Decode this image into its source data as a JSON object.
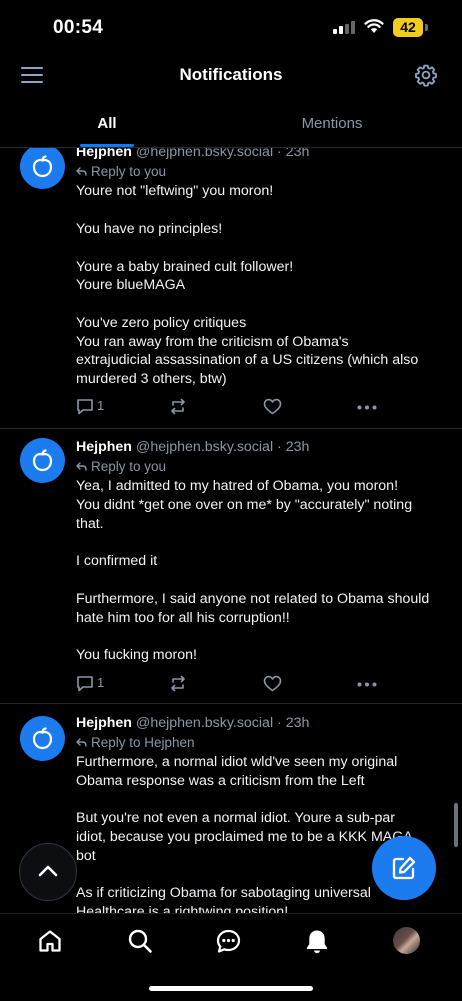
{
  "status_bar": {
    "time": "00:54",
    "battery": "42"
  },
  "header": {
    "title": "Notifications"
  },
  "tabs": [
    {
      "label": "All",
      "selected": true
    },
    {
      "label": "Mentions",
      "selected": false
    }
  ],
  "posts": [
    {
      "author": "Hejphen",
      "handle": "@hejphen.bsky.social",
      "time": "· 23h",
      "reply_to": "Reply to you",
      "body": [
        "Youre not \"leftwing\" you moron!",
        "",
        "You have no principles!",
        "",
        "Youre a baby brained cult follower!",
        "Youre blueMAGA",
        "",
        "You've zero policy critiques",
        "You ran away from the criticism of Obama's",
        "extrajudicial assassination of a US citizens (which also",
        "murdered 3 others, btw)"
      ],
      "reply_count": "1"
    },
    {
      "author": "Hejphen",
      "handle": "@hejphen.bsky.social",
      "time": "· 23h",
      "reply_to": "Reply to you",
      "body": [
        "Yea, I admitted to my hatred of Obama, you moron!",
        "You didnt *get one over on me* by \"accurately\" noting",
        "that.",
        "",
        "I confirmed it",
        "",
        "Furthermore, I said anyone not related to Obama should",
        "hate him too for all his corruption!!",
        "",
        "You fucking moron!"
      ],
      "reply_count": "1"
    },
    {
      "author": "Hejphen",
      "handle": "@hejphen.bsky.social",
      "time": "· 23h",
      "reply_to": "Reply to Hejphen",
      "body": [
        "Furthermore, a normal idiot wld've seen my original",
        "Obama response was a criticism from the Left",
        "",
        "But you're not even a normal idiot. Youre a sub-par",
        "idiot, because you proclaimed me to be a KKK MAGA",
        "bot",
        "",
        "As if criticizing Obama for sabotaging universal",
        "Healthcare is a rightwing position!"
      ],
      "reply_count": ""
    }
  ],
  "icons": {
    "menu": "menu-icon",
    "settings": "gear-icon",
    "avatar": "apple-icon",
    "reply": "reply-arrow-icon",
    "comment": "comment-icon",
    "repost": "repost-icon",
    "like": "heart-icon",
    "more": "ellipsis-icon",
    "scroll_top": "chevron-up-icon",
    "compose": "compose-icon",
    "nav": [
      "home-icon",
      "search-icon",
      "chat-icon",
      "bell-icon",
      "profile-avatar"
    ]
  },
  "colors": {
    "accent": "#1d7bf0",
    "muted": "#8a96a6",
    "background": "#000000",
    "battery": "#f2cc1c"
  }
}
